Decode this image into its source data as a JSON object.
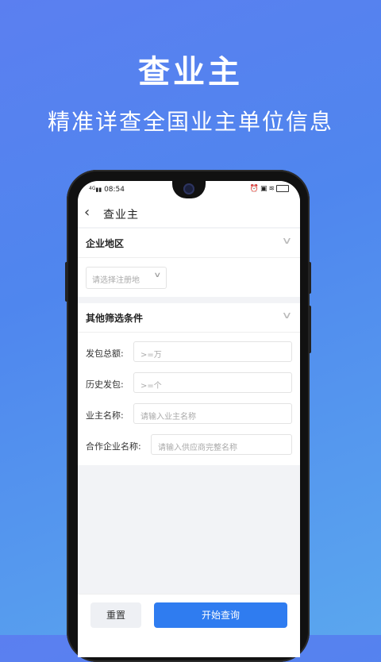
{
  "promo": {
    "title": "查业主",
    "subtitle": "精准详查全国业主单位信息"
  },
  "status_bar": {
    "network": "4G",
    "time": "08:54",
    "icons": [
      "alarm-icon",
      "vibrate-icon",
      "wifi-icon",
      "battery-icon"
    ]
  },
  "nav": {
    "back_icon": "‹",
    "title": "查业主"
  },
  "region_card": {
    "title": "企业地区",
    "select_placeholder": "请选择注册地"
  },
  "filter_card": {
    "title": "其他筛选条件",
    "fields": [
      {
        "label": "发包总额:",
        "placeholder": ">=万"
      },
      {
        "label": "历史发包:",
        "placeholder": ">=个"
      },
      {
        "label": "业主名称:",
        "placeholder": "请输入业主名称"
      },
      {
        "label": "合作企业名称:",
        "placeholder": "请输入供应商完整名称"
      }
    ]
  },
  "buttons": {
    "reset": "重置",
    "search": "开始查询"
  }
}
